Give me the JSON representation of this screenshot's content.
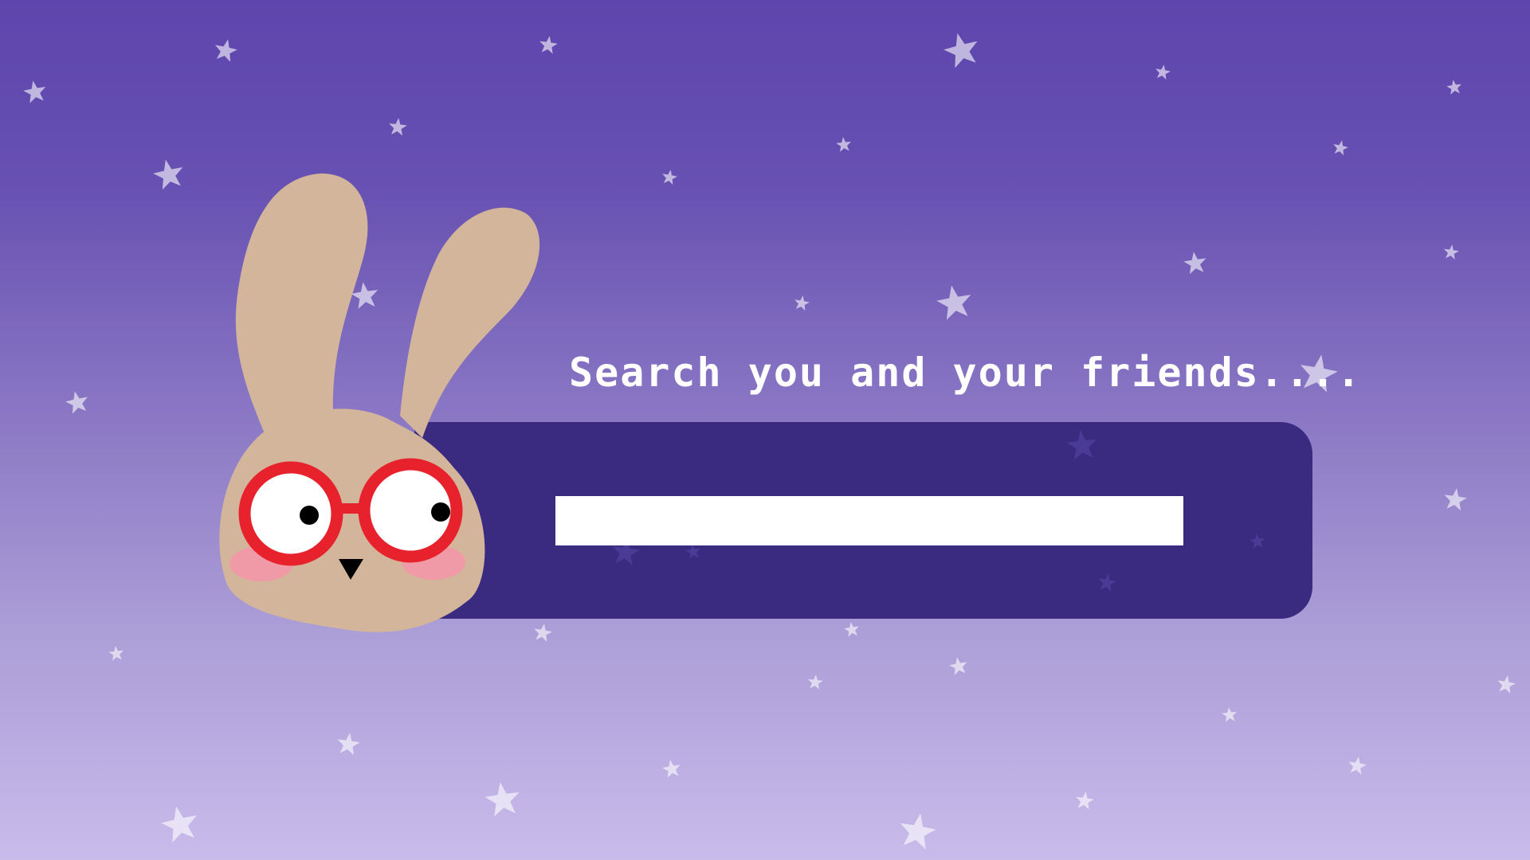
{
  "search": {
    "heading": "Search you and your friends....",
    "value": ""
  },
  "colors": {
    "background_top": "#5d45ad",
    "background_bottom": "#c9bbea",
    "panel": "#3a2b81",
    "input": "#ffffff",
    "bunny_fur": "#d2b59a",
    "glasses": "#e8222d",
    "blush": "#f19aa7",
    "star": "#ffffff"
  },
  "icons": {
    "mascot": "bunny-with-glasses-icon",
    "decoration": "star-icon"
  }
}
